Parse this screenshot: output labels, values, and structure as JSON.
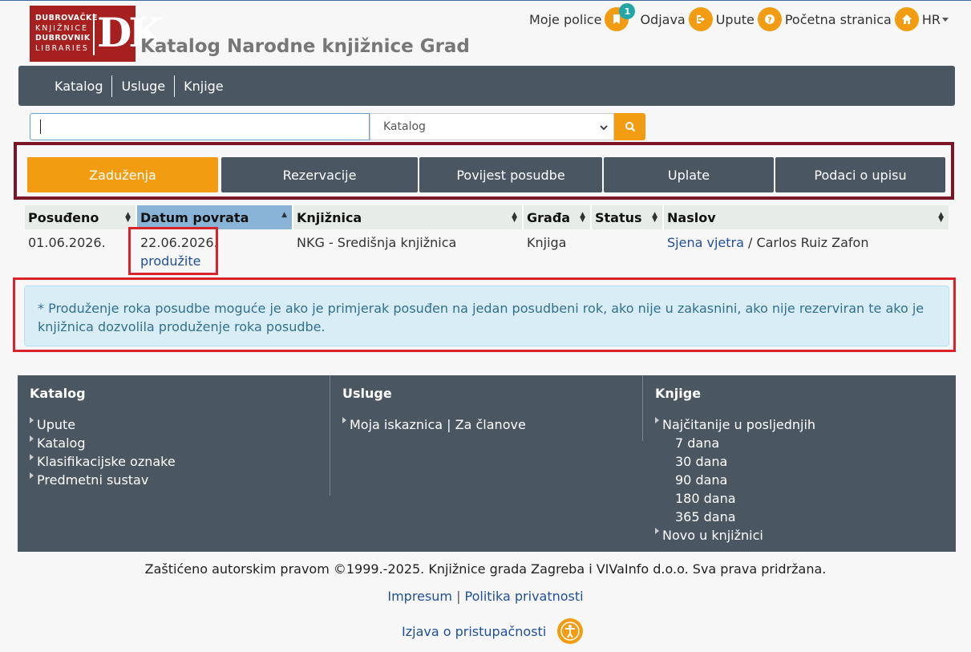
{
  "header": {
    "logo": {
      "line1": "DUBROVAČKE",
      "line2": "KNJIŽNICE",
      "line3": "DUBROVNIK",
      "line4": "LIBRARIES",
      "mark": "DK"
    },
    "site_title": "Katalog Narodne knjižnice Grad",
    "links": {
      "shelves": "Moje police",
      "shelves_badge": "1",
      "logout": "Odjava",
      "help": "Upute",
      "home": "Početna stranica",
      "lang": "HR"
    }
  },
  "nav": {
    "items": [
      "Katalog",
      "Usluge",
      "Knjige"
    ]
  },
  "search": {
    "value": "",
    "scope": "Katalog"
  },
  "tabs": [
    "Zaduženja",
    "Rezervacije",
    "Povijest posudbe",
    "Uplate",
    "Podaci o upisu"
  ],
  "table": {
    "headers": [
      "Posuđeno",
      "Datum povrata",
      "Knjižnica",
      "Građa",
      "Status",
      "Naslov"
    ],
    "rows": [
      {
        "borrowed": "01.06.2026.",
        "due": "22.06.2026.",
        "renew": "produžite",
        "library": "NKG - Središnja knjižnica",
        "material": "Knjiga",
        "status": "",
        "title": "Sjena vjetra",
        "author": " / Carlos Ruiz Zafon"
      }
    ]
  },
  "info": "* Produženje roka posudbe moguće je ako je primjerak posuđen na jedan posudbeni rok, ako nije u zakasnini, ako nije rezerviran te ako je knjižnica dozvolila produženje roka posudbe.",
  "footer": {
    "col1": {
      "title": "Katalog",
      "items": [
        "Upute",
        "Katalog",
        "Klasifikacijske oznake",
        "Predmetni sustav"
      ]
    },
    "col2": {
      "title": "Usluge",
      "items": [
        "Moja iskaznica | Za članove"
      ]
    },
    "col3": {
      "title": "Knjige",
      "item1": "Najčitanije u posljednjih",
      "sub": [
        "7 dana",
        "30 dana",
        "90 dana",
        "180 dana",
        "365 dana"
      ],
      "item2": "Novo u knjižnici"
    }
  },
  "copyright": "Zaštićeno autorskim pravom ©1999.-2025. Knjižnice grada Zagreba i VIVaInfo d.o.o. Sva prava pridržana.",
  "legal": {
    "impressum": "Impresum",
    "sep": "|",
    "privacy": "Politika privatnosti"
  },
  "accessibility": "Izjava o pristupačnosti",
  "colors": {
    "accent": "#f29c11",
    "nav": "#4a5763",
    "badge": "#25a6a6",
    "highlight": "#d9222a",
    "frame": "#7a1626"
  }
}
